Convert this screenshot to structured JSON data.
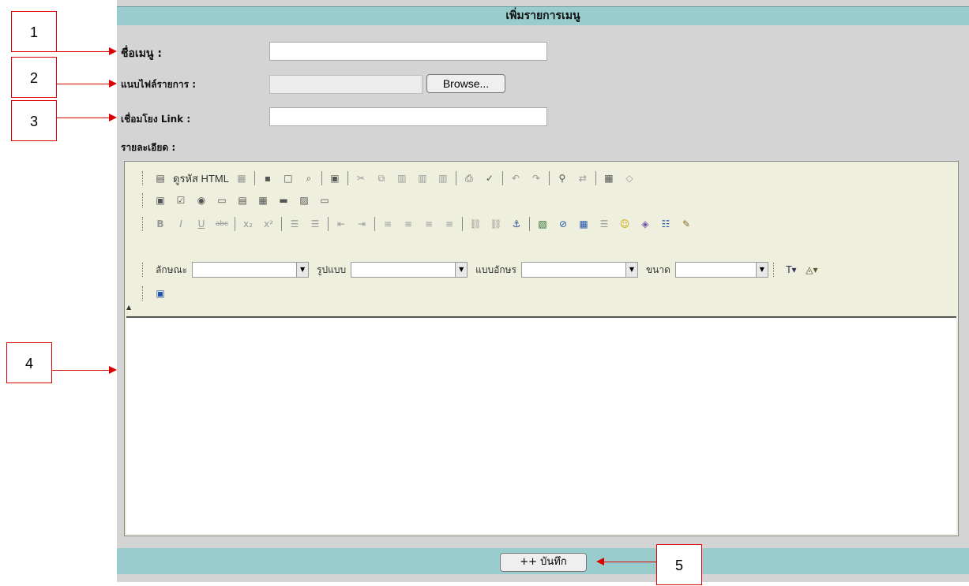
{
  "header": {
    "title": "เพิ่มรายการเมนู"
  },
  "form": {
    "menu_name_label": "ชื่อเมนู :",
    "menu_name_value": "",
    "attach_label": "แนบไฟล์รายการ :",
    "browse_label": "Browse...",
    "link_label": "เชื่อมโยง Link :",
    "link_value": "",
    "detail_label": "รายละเอียด :"
  },
  "editor": {
    "source_label": "ดูรหัส HTML",
    "style_label": "ลักษณะ",
    "format_label": "รูปแบบ",
    "font_label": "แบบอักษร",
    "size_label": "ขนาด",
    "style_value": "",
    "format_value": "",
    "font_value": "",
    "size_value": "",
    "content": ""
  },
  "footer": {
    "save_label": "++ บันทึก"
  },
  "callouts": [
    "1",
    "2",
    "3",
    "4",
    "5"
  ]
}
